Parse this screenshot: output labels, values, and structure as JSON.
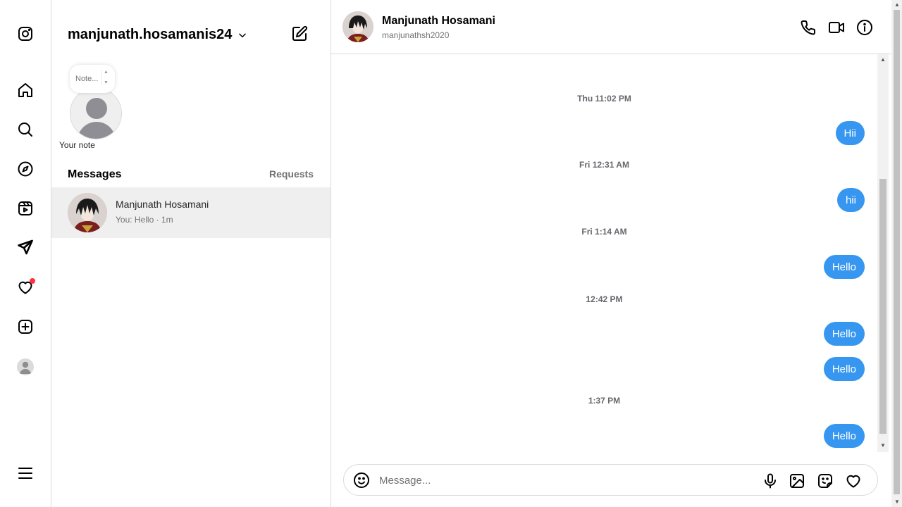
{
  "nav": {
    "items": [
      {
        "icon": "instagram-logo-icon"
      },
      {
        "icon": "home-icon"
      },
      {
        "icon": "search-icon"
      },
      {
        "icon": "explore-compass-icon"
      },
      {
        "icon": "reels-icon"
      },
      {
        "icon": "messages-direct-icon"
      },
      {
        "icon": "notifications-heart-icon",
        "has_notification": true
      },
      {
        "icon": "create-plus-icon"
      },
      {
        "icon": "profile-avatar-icon"
      },
      {
        "icon": "more-menu-icon"
      }
    ],
    "notification_color": "#ff3040"
  },
  "list": {
    "account_name": "manjunath.hosamanis24",
    "note_placeholder": "Note...",
    "note_label": "Your note",
    "messages_heading": "Messages",
    "requests_label": "Requests",
    "conversations": [
      {
        "name": "Manjunath Hosamani",
        "preview": "You: Hello · 1m",
        "selected": true
      }
    ]
  },
  "chat": {
    "name": "Manjunath Hosamani",
    "username": "manjunathsh2020",
    "timeline": [
      {
        "type": "timestamp",
        "text": "Thu 11:02 PM"
      },
      {
        "type": "message",
        "text": "Hii"
      },
      {
        "type": "timestamp",
        "text": "Fri 12:31 AM"
      },
      {
        "type": "message",
        "text": "hii"
      },
      {
        "type": "timestamp",
        "text": "Fri 1:14 AM"
      },
      {
        "type": "message",
        "text": "Hello"
      },
      {
        "type": "timestamp",
        "text": "12:42 PM"
      },
      {
        "type": "message",
        "text": "Hello"
      },
      {
        "type": "message",
        "text": "Hello"
      },
      {
        "type": "timestamp",
        "text": "1:37 PM"
      },
      {
        "type": "message",
        "text": "Hello"
      }
    ],
    "input_placeholder": "Message...",
    "bubble_color": "#3797f0"
  }
}
